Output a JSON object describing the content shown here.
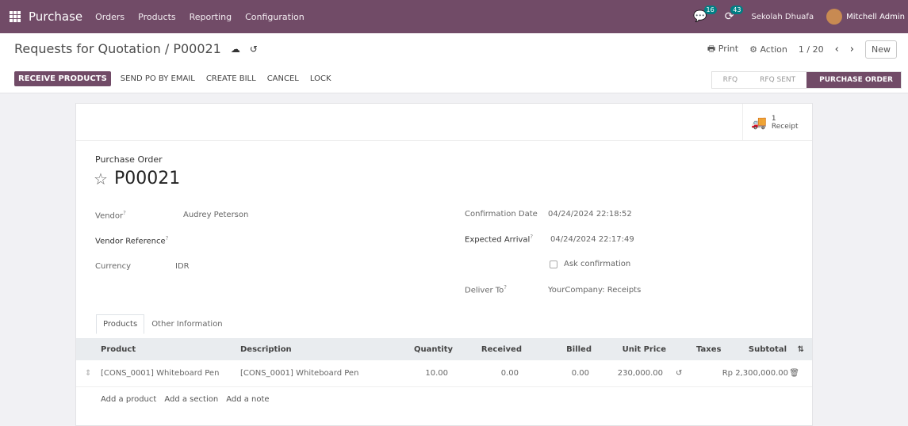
{
  "navbar": {
    "app_name": "Purchase",
    "menu": [
      "Orders",
      "Products",
      "Reporting",
      "Configuration"
    ],
    "messages_badge": "16",
    "activities_badge": "43",
    "company": "Sekolah Dhuafa",
    "user": "Mitchell Admin"
  },
  "control_panel": {
    "breadcrumb": "Requests for Quotation / P00021",
    "print_label": "Print",
    "action_label": "Action",
    "pager": "1 / 20",
    "new_label": "New"
  },
  "actions": {
    "receive_products": "RECEIVE PRODUCTS",
    "send_po": "SEND PO BY EMAIL",
    "create_bill": "CREATE BILL",
    "cancel": "CANCEL",
    "lock": "LOCK"
  },
  "statusbar": {
    "steps": [
      "RFQ",
      "RFQ SENT",
      "PURCHASE ORDER"
    ],
    "active": "PURCHASE ORDER"
  },
  "smart_button": {
    "count": "1",
    "label": "Receipt"
  },
  "form": {
    "doc_label": "Purchase Order",
    "doc_name": "P00021",
    "vendor_label": "Vendor",
    "vendor_value": "Audrey Peterson",
    "vendor_ref_label": "Vendor Reference",
    "currency_label": "Currency",
    "currency_value": "IDR",
    "confirmation_label": "Confirmation Date",
    "confirmation_value": "04/24/2024 22:18:52",
    "expected_label": "Expected Arrival",
    "expected_value": "04/24/2024 22:17:49",
    "ask_confirmation": "Ask confirmation",
    "deliver_label": "Deliver To",
    "deliver_value": "YourCompany: Receipts"
  },
  "tabs": [
    "Products",
    "Other Information"
  ],
  "table": {
    "columns": [
      "Product",
      "Description",
      "Quantity",
      "Received",
      "Billed",
      "Unit Price",
      "Taxes",
      "Subtotal"
    ],
    "rows": [
      {
        "product": "[CONS_0001] Whiteboard Pen",
        "description": "[CONS_0001] Whiteboard Pen",
        "quantity": "10.00",
        "received": "0.00",
        "billed": "0.00",
        "unit_price": "230,000.00",
        "taxes": "",
        "subtotal": "Rp 2,300,000.00"
      }
    ],
    "add_product": "Add a product",
    "add_section": "Add a section",
    "add_note": "Add a note"
  }
}
